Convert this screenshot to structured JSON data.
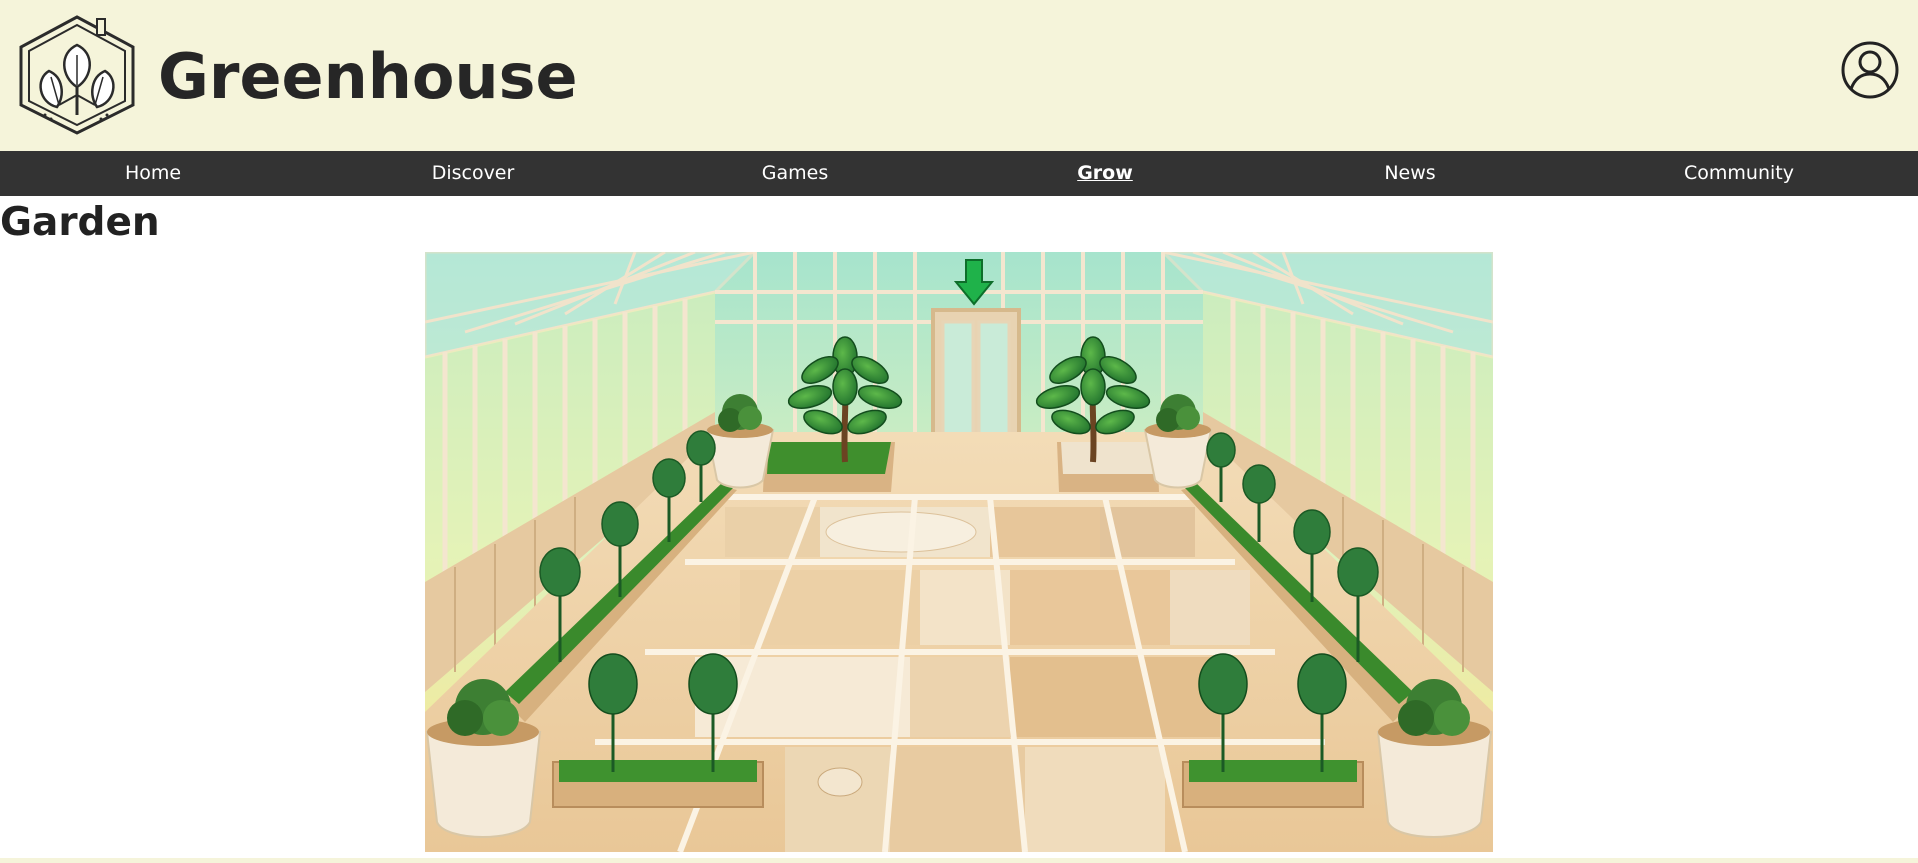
{
  "header": {
    "site_title": "Greenhouse",
    "logo_icon": "leaf-house-logo-icon",
    "account_icon": "user-avatar-icon",
    "background": "#f5f4da"
  },
  "nav": {
    "background": "#333333",
    "items": [
      {
        "label": "Home",
        "active": false
      },
      {
        "label": "Discover",
        "active": false
      },
      {
        "label": "Games",
        "active": false
      },
      {
        "label": "Grow",
        "active": true
      },
      {
        "label": "News",
        "active": false
      },
      {
        "label": "Community",
        "active": false
      }
    ]
  },
  "main": {
    "heading": "Garden",
    "scene": {
      "description_icon": "greenhouse-garden-scene",
      "exit_indicator_icon": "down-arrow-icon",
      "accent_green": "#1fb24a"
    }
  }
}
